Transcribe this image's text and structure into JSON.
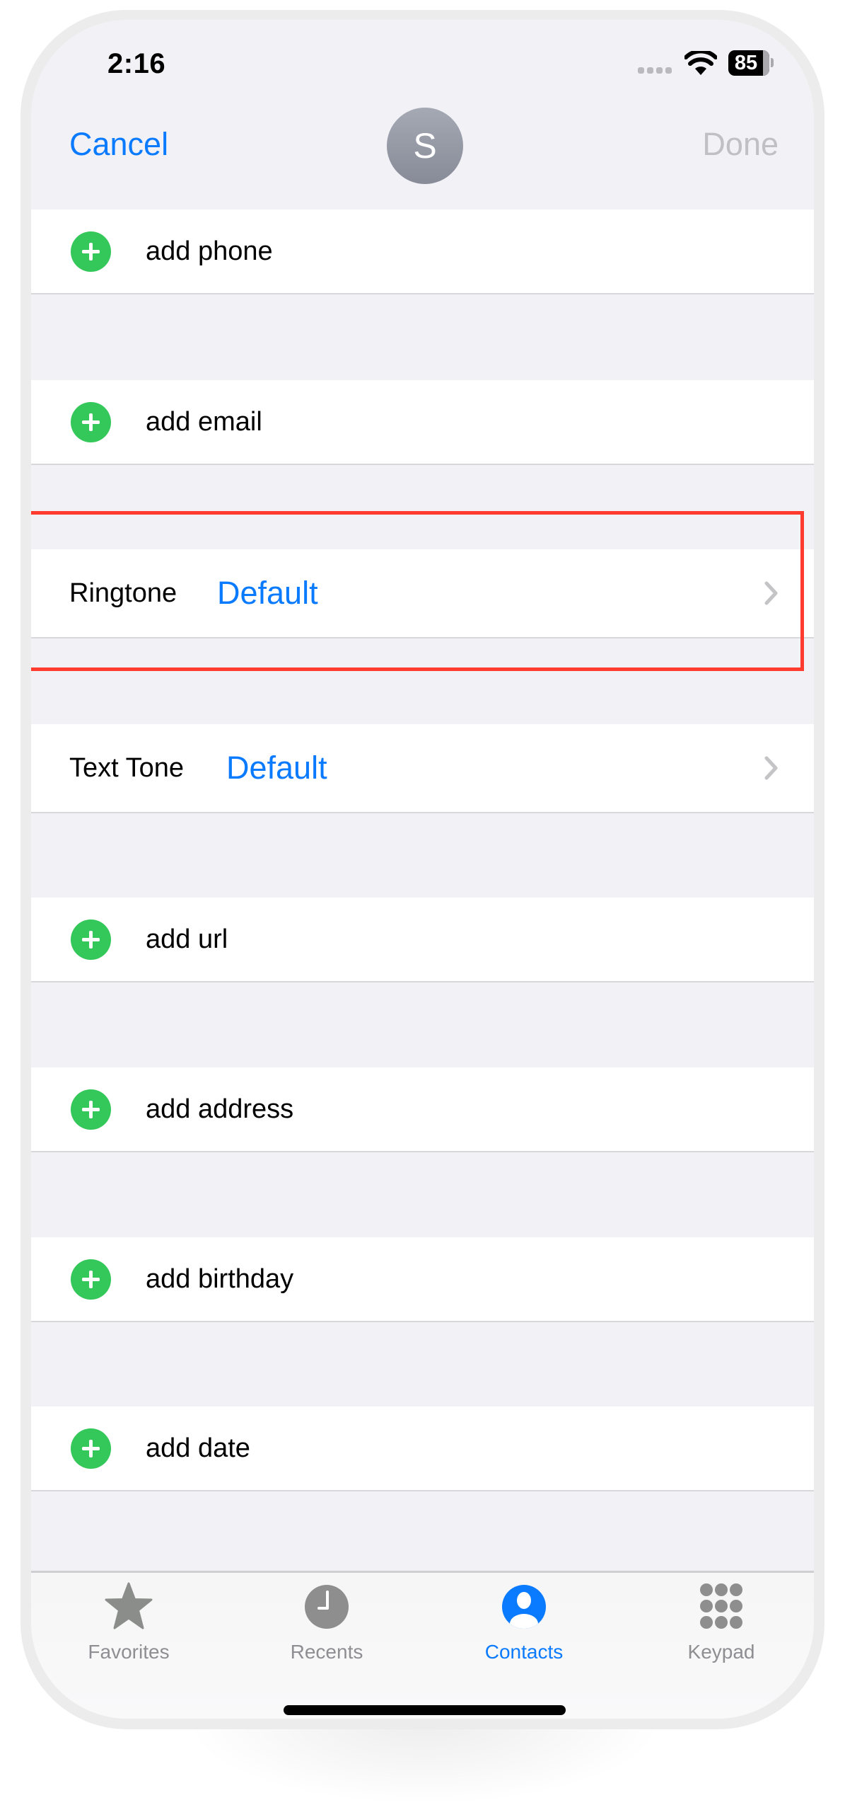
{
  "status_bar": {
    "time": "2:16",
    "battery": "85"
  },
  "nav": {
    "cancel_label": "Cancel",
    "avatar_initial": "S",
    "done_label": "Done"
  },
  "rows": [
    {
      "type": "add",
      "label": "add phone"
    },
    {
      "type": "add",
      "label": "add email"
    },
    {
      "type": "tone",
      "label": "Ringtone",
      "value": "Default"
    },
    {
      "type": "tone",
      "label": "Text Tone",
      "value": "Default"
    },
    {
      "type": "add",
      "label": "add url"
    },
    {
      "type": "add",
      "label": "add address"
    },
    {
      "type": "add",
      "label": "add birthday"
    },
    {
      "type": "add",
      "label": "add date"
    }
  ],
  "tabs": [
    {
      "label": "Favorites",
      "icon": "star-icon",
      "active": false
    },
    {
      "label": "Recents",
      "icon": "clock-icon",
      "active": false
    },
    {
      "label": "Contacts",
      "icon": "person-circle-icon",
      "active": true
    },
    {
      "label": "Keypad",
      "icon": "keypad-icon",
      "active": false
    }
  ],
  "colors": {
    "accent": "#0a7aff",
    "add_green": "#34c759",
    "highlight_red": "#ff3b30",
    "disabled": "#c0c0c4"
  }
}
